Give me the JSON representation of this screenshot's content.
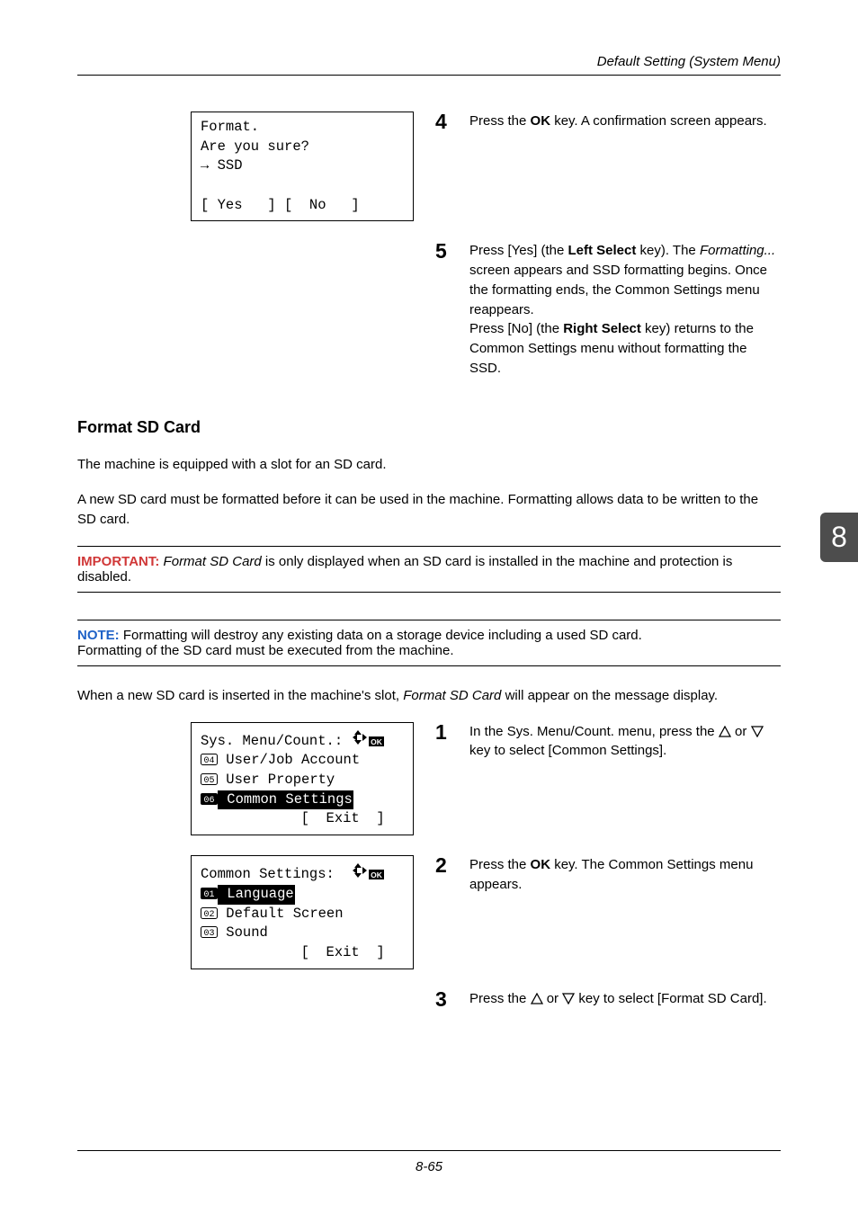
{
  "header": {
    "running": "Default Setting (System Menu)"
  },
  "lcd1": {
    "l1": "Format.",
    "l2": "Are you sure?",
    "l3": "→ SSD",
    "l4": "",
    "l5": "[ Yes   ] [  No   ]"
  },
  "step4": {
    "num": "4",
    "t1": "Press the ",
    "t2_bold": "OK",
    "t3": " key. A confirmation screen appears."
  },
  "step5": {
    "num": "5",
    "t1": "Press [Yes] (the ",
    "t2_bold": "Left Select",
    "t3": " key). The ",
    "t4_italic": "Formatting...",
    "t5": " screen appears and SSD formatting begins. Once the formatting ends, the Common Settings menu reappears.",
    "t6": "Press [No] (the ",
    "t7_bold": "Right Select",
    "t8": " key) returns to the Common Settings menu without formatting the SSD."
  },
  "h_format": "Format SD Card",
  "p1": "The machine is equipped with a slot for an SD card.",
  "p2": "A new SD card must be formatted before it can be used in the machine. Formatting allows data to be written to the SD card.",
  "important": {
    "label": "IMPORTANT:",
    "t1_italic": " Format SD Card",
    "t2": " is only displayed when an SD card is installed in the machine and protection is disabled."
  },
  "note": {
    "label": "NOTE:",
    "t1": " Formatting will destroy any existing data on a storage device including a used SD card.",
    "t2": "Formatting of the SD card must be executed from the machine."
  },
  "p3a": "When a new SD card is inserted in the machine's slot, ",
  "p3b_italic": "Format SD Card",
  "p3c": " will appear on the message display.",
  "lcd2": {
    "title": "Sys. Menu/Count.:",
    "i1n": "4",
    "i1": " User/Job Account",
    "i2n": "5",
    "i2": " User Property",
    "i3n": "6",
    "i3": " Common Settings",
    "exit": "[  Exit  ]"
  },
  "lcd3": {
    "title": "Common Settings:",
    "i1n": "1",
    "i1": " Language",
    "i2n": "2",
    "i2": " Default Screen",
    "i3n": "3",
    "i3": " Sound",
    "exit": "[  Exit  ]"
  },
  "step1": {
    "num": "1",
    "t1": "In the Sys. Menu/Count. menu, press the ",
    "t2": " or ",
    "t3": " key to select [Common Settings]."
  },
  "step2": {
    "num": "2",
    "t1": "Press the ",
    "t2_bold": "OK",
    "t3": " key. The Common Settings menu appears."
  },
  "step3": {
    "num": "3",
    "t1": "Press the ",
    "t2": " or ",
    "t3": " key to select [Format SD Card]."
  },
  "tab": "8",
  "page_number": "8-65"
}
